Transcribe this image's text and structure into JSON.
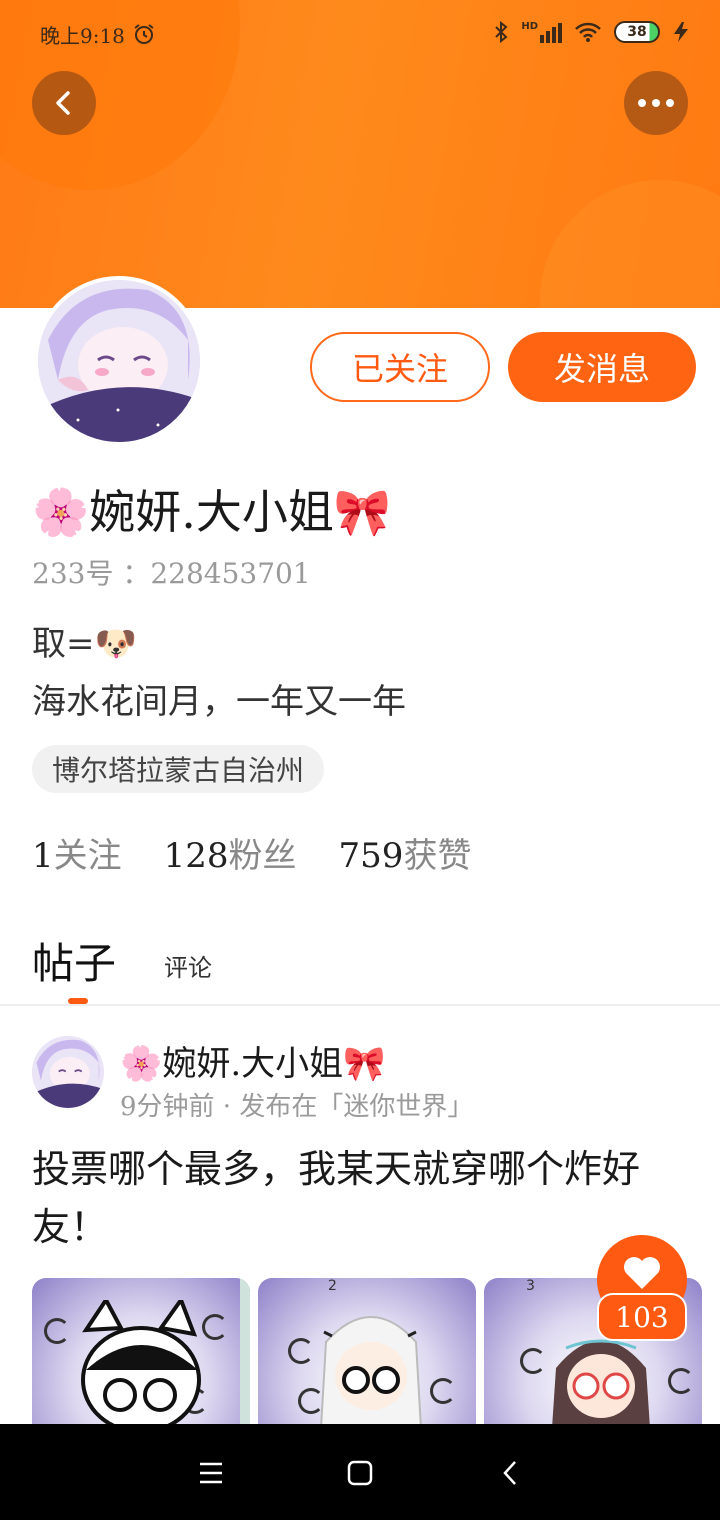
{
  "status_bar": {
    "time": "晚上9:18",
    "network": "HD",
    "battery": "38"
  },
  "profile": {
    "name": "🌸婉妍.大小姐🎀",
    "uid": "233号 ：228453701",
    "bio_line1": "取=🐶",
    "bio_line2": "海水花间月，一年又一年",
    "location": "博尔塔拉蒙古自治州",
    "follow_label": "已关注",
    "message_label": "发消息"
  },
  "stats": [
    {
      "value": "1",
      "label": "关注"
    },
    {
      "value": "128",
      "label": "粉丝"
    },
    {
      "value": "759",
      "label": "获赞"
    }
  ],
  "tabs": {
    "posts": "帖子",
    "comments": "评论"
  },
  "post": {
    "author": "🌸婉妍.大小姐🎀",
    "meta": "9分钟前 · 发布在「迷你世界」",
    "text": "投票哪个最多，我某天就穿哪个炸好友！",
    "thumb_numbers": [
      "",
      "2",
      "3"
    ],
    "like_count": "103"
  },
  "colors": {
    "accent": "#ff5a12",
    "banner": "#ff7d18"
  },
  "icons": [
    "back-icon",
    "more-icon",
    "alarm-icon",
    "bluetooth-icon",
    "signal-icon",
    "wifi-icon",
    "battery-icon",
    "heart-icon",
    "menu-icon",
    "home-icon",
    "nav-back-icon"
  ]
}
